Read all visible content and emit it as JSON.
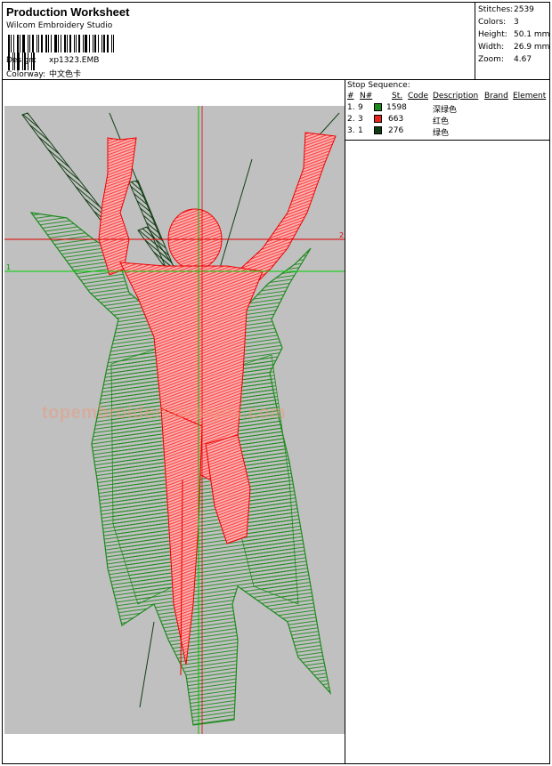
{
  "header": {
    "title": "Production Worksheet",
    "software": "Wilcom Embroidery Studio",
    "design_label": "Design:",
    "design_value": "xp1323.EMB",
    "colorway_label": "Colorway:",
    "colorway_value": "中文色卡"
  },
  "stats": [
    {
      "label": "Stitches:",
      "value": "2539"
    },
    {
      "label": "Colors:",
      "value": "3"
    },
    {
      "label": "Height:",
      "value": "50.1 mm"
    },
    {
      "label": "Width:",
      "value": "26.9 mm"
    },
    {
      "label": "Zoom:",
      "value": "4.67"
    }
  ],
  "stop_sequence": {
    "title": "Stop Sequence:",
    "columns": [
      "#",
      "N#",
      "St.",
      "Code",
      "Description",
      "Brand",
      "Element"
    ],
    "rows": [
      {
        "num": "1.",
        "n": "9",
        "color": "#1a8a1a",
        "st": "1598",
        "desc": "深绿色"
      },
      {
        "num": "2.",
        "n": "3",
        "color": "#e8231b",
        "st": "663",
        "desc": "红色"
      },
      {
        "num": "3.",
        "n": "1",
        "color": "#0f3d12",
        "st": "276",
        "desc": "绿色"
      }
    ]
  },
  "canvas": {
    "watermark": "topembroiderydesigns.com",
    "marker_1": "1",
    "marker_2": "2"
  }
}
